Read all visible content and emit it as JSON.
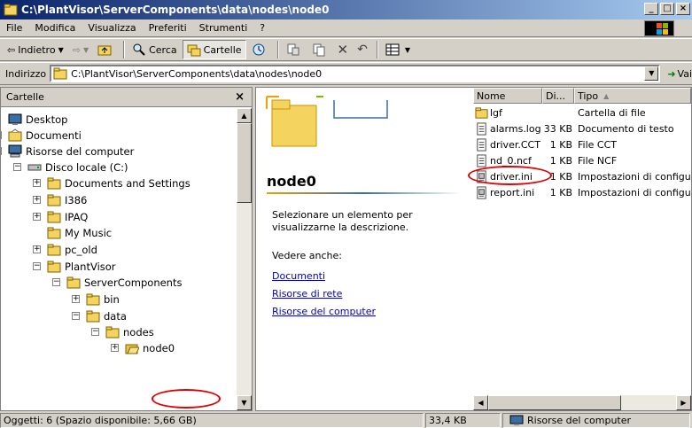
{
  "window": {
    "title": "C:\\PlantVisor\\ServerComponents\\data\\nodes\\node0"
  },
  "menu": [
    "File",
    "Modifica",
    "Visualizza",
    "Preferiti",
    "Strumenti",
    "?"
  ],
  "toolbar": {
    "back_label": "Indietro",
    "search_label": "Cerca",
    "folders_label": "Cartelle"
  },
  "address": {
    "label": "Indirizzo",
    "value": "C:\\PlantVisor\\ServerComponents\\data\\nodes\\node0",
    "go_label": "Vai"
  },
  "folders_pane": {
    "title": "Cartelle",
    "tree": [
      {
        "label": "Desktop",
        "icon": "desktop-icon",
        "expander": ""
      },
      {
        "label": "Documenti",
        "icon": "documents-icon",
        "expander": "+"
      },
      {
        "label": "Risorse del computer",
        "icon": "computer-icon",
        "expander": "-"
      },
      {
        "label": "Disco locale (C:)",
        "icon": "disk-icon",
        "expander": "-"
      },
      {
        "label": "Documents and Settings",
        "icon": "folder-icon",
        "expander": "+"
      },
      {
        "label": "I386",
        "icon": "folder-icon",
        "expander": "+"
      },
      {
        "label": "IPAQ",
        "icon": "folder-icon",
        "expander": "+"
      },
      {
        "label": "My Music",
        "icon": "folder-icon",
        "expander": ""
      },
      {
        "label": "pc_old",
        "icon": "folder-icon",
        "expander": "+"
      },
      {
        "label": "PlantVisor",
        "icon": "folder-icon",
        "expander": "-"
      },
      {
        "label": "ServerComponents",
        "icon": "folder-icon",
        "expander": "-"
      },
      {
        "label": "bin",
        "icon": "folder-icon",
        "expander": "+"
      },
      {
        "label": "data",
        "icon": "folder-icon",
        "expander": "-"
      },
      {
        "label": "nodes",
        "icon": "folder-icon",
        "expander": "-"
      },
      {
        "label": "node0",
        "icon": "folder-open-icon",
        "expander": "+",
        "selected": true
      }
    ]
  },
  "webview": {
    "folder_name": "node0",
    "description": "Selezionare un elemento per visualizzarne la descrizione.",
    "see_also_label": "Vedere anche:",
    "links": [
      "Documenti",
      "Risorse di rete",
      "Risorse del computer"
    ]
  },
  "file_list": {
    "columns": [
      "Nome",
      "Di...",
      "Tipo"
    ],
    "sort_indicator": "▲",
    "rows": [
      {
        "name": "lgf",
        "size": "",
        "type": "Cartella di file",
        "icon": "folder-icon"
      },
      {
        "name": "alarms.log",
        "size": "33 KB",
        "type": "Documento di testo",
        "icon": "text-file-icon"
      },
      {
        "name": "driver.CCT",
        "size": "1 KB",
        "type": "File CCT",
        "icon": "text-file-icon"
      },
      {
        "name": "nd_0.ncf",
        "size": "1 KB",
        "type": "File NCF",
        "icon": "text-file-icon"
      },
      {
        "name": "driver.ini",
        "size": "1 KB",
        "type": "Impostazioni di configurazione",
        "icon": "ini-file-icon"
      },
      {
        "name": "report.ini",
        "size": "1 KB",
        "type": "Impostazioni di configurazione",
        "icon": "ini-file-icon"
      }
    ]
  },
  "status": {
    "objects": "Oggetti: 6 (Spazio disponibile: 5,66 GB)",
    "size": "33,4 KB",
    "zone": "Risorse del computer"
  },
  "colors": {
    "titlebar_start": "#0a246a",
    "titlebar_end": "#a6caf0",
    "annotation": "#e00000",
    "link": "#0000cc"
  }
}
